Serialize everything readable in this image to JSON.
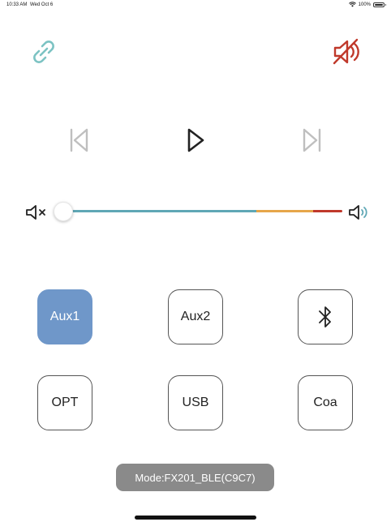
{
  "status_bar": {
    "time": "10:33 AM",
    "date": "Wed Oct 6",
    "battery": "100%"
  },
  "icons": {
    "link": "link-icon",
    "mute": "speaker-muted-icon",
    "previous": "skip-previous-icon",
    "play": "play-icon",
    "next": "skip-next-icon",
    "volume_min": "volume-mute-small-icon",
    "volume_max": "volume-high-icon",
    "bluetooth": "bluetooth-icon"
  },
  "colors": {
    "link": "#7cc3c3",
    "mute": "#c0392b",
    "track_blue": "#5fa7b5",
    "track_orange": "#e6a64a",
    "track_red": "#c0392b",
    "active_source": "#6f97c9",
    "toast": "#8a8a8a"
  },
  "volume": {
    "level_fraction": 0.0
  },
  "sources": [
    {
      "label": "Aux1",
      "active": true
    },
    {
      "label": "Aux2",
      "active": false
    },
    {
      "label": "",
      "icon": "bluetooth-icon",
      "active": false
    },
    {
      "label": "OPT",
      "active": false
    },
    {
      "label": "USB",
      "active": false
    },
    {
      "label": "Coa",
      "active": false
    }
  ],
  "mode_text": "Mode:FX201_BLE(C9C7)"
}
